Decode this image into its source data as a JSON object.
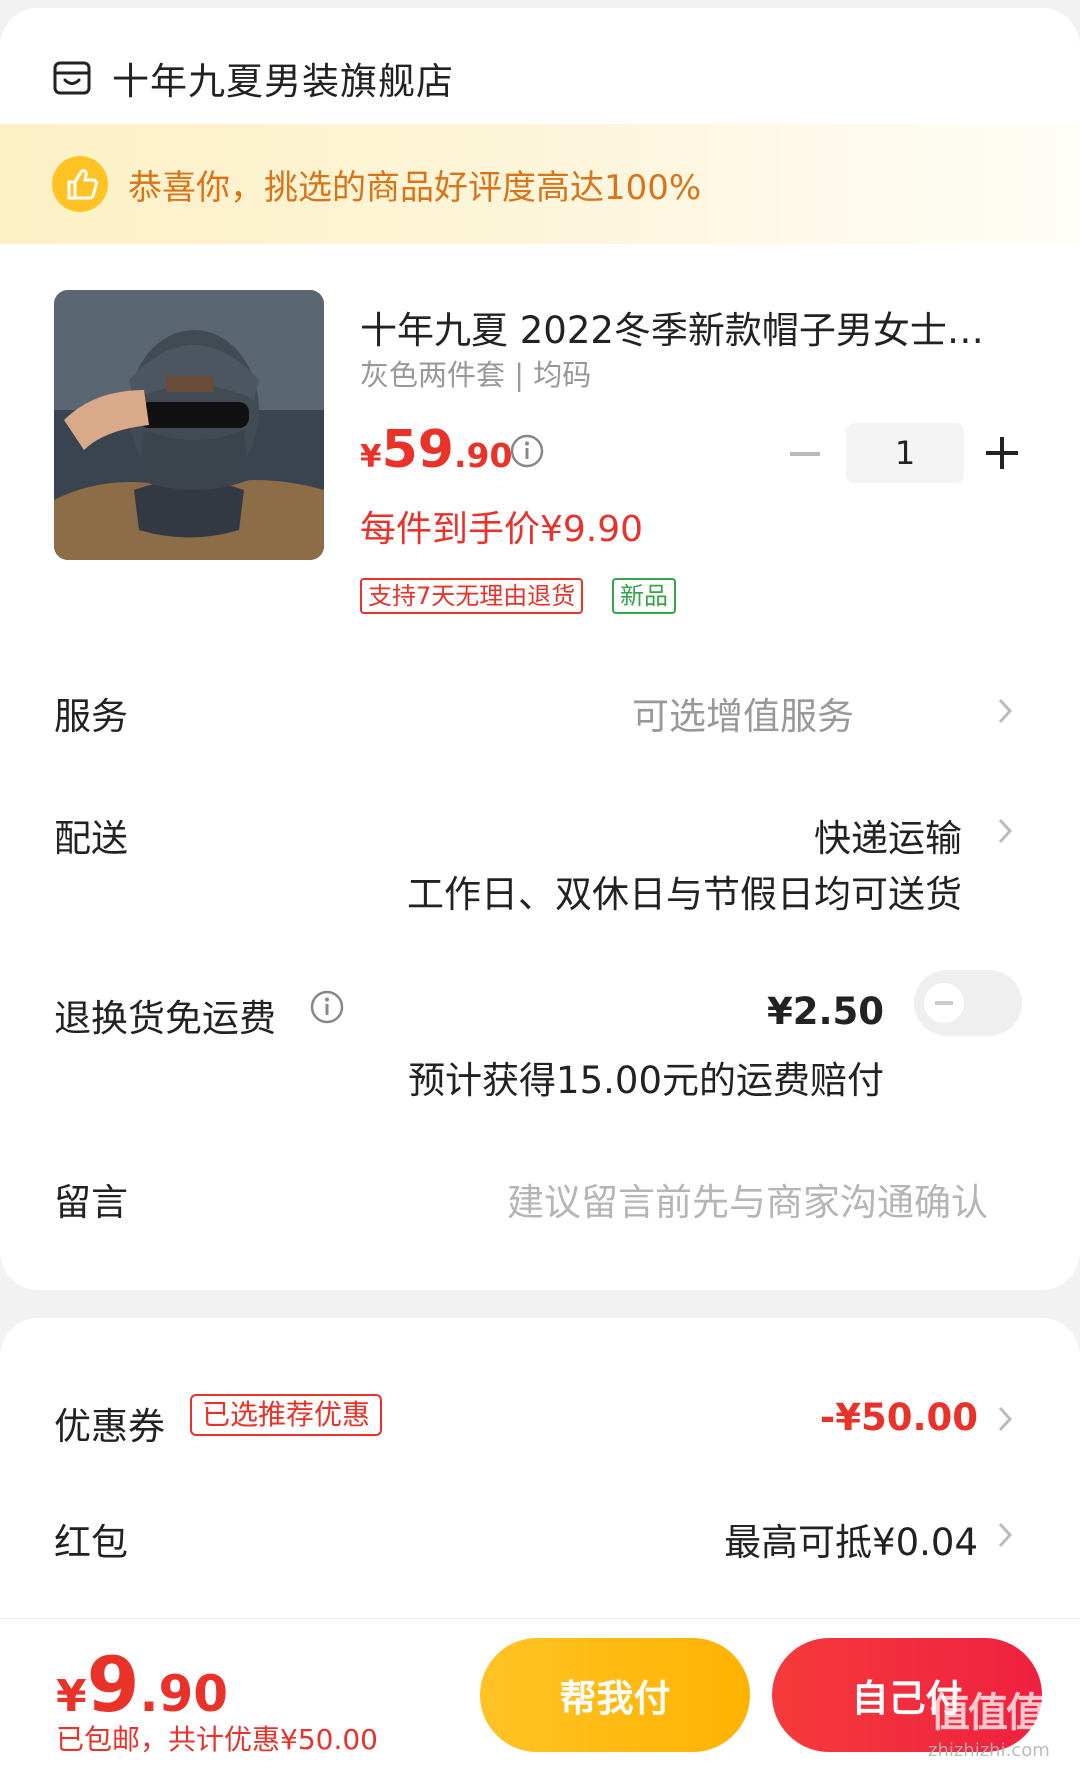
{
  "shop": {
    "name": "十年九夏男装旗舰店",
    "icon": "store-icon"
  },
  "banner": {
    "text": "恭喜你，挑选的商品好评度高达100%",
    "icon": "thumbs-up-icon"
  },
  "product": {
    "title": "十年九夏 2022冬季新款帽子男女士…",
    "spec": "灰色两件套 | 均码",
    "price_currency": "¥",
    "price_int": "59",
    "price_dec": ".90",
    "unit_price": "每件到手价¥9.90",
    "quantity": "1",
    "tags": {
      "return": "支持7天无理由退货",
      "new": "新品"
    }
  },
  "rows": {
    "service": {
      "label": "服务",
      "value": "可选增值服务"
    },
    "delivery": {
      "label": "配送",
      "value": "快递运输",
      "note": "工作日、双休日与节假日均可送货"
    },
    "return_fee": {
      "label": "退换货免运费",
      "value": "¥2.50",
      "note": "预计获得15.00元的运费赔付",
      "toggle_on": false
    },
    "message": {
      "label": "留言",
      "placeholder": "建议留言前先与商家沟通确认"
    }
  },
  "discounts": {
    "coupon": {
      "label": "优惠券",
      "badge": "已选推荐优惠",
      "value": "-¥50.00"
    },
    "red_packet": {
      "label": "红包",
      "value": "最高可抵¥0.04"
    }
  },
  "footer": {
    "total_currency": "¥",
    "total_int": "9",
    "total_dec": ".90",
    "summary": "已包邮，共计优惠¥50.00",
    "help_pay": "帮我付",
    "self_pay": "自己付"
  },
  "watermark": {
    "main": "值值值",
    "sub": "zhizhizhi.com"
  },
  "colors": {
    "accent_red": "#e8322a",
    "accent_yellow": "#ffb300",
    "banner_text": "#d9741a",
    "tag_green": "#35a44a"
  }
}
